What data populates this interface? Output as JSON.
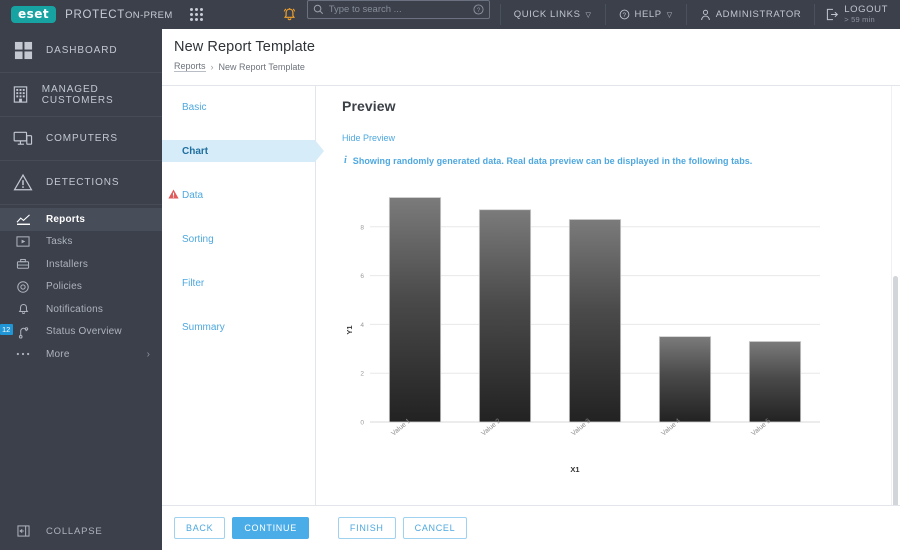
{
  "header": {
    "logo_text": "eset",
    "product_name": "PROTECT",
    "product_suffix": "ON-PREM",
    "bell_icon": "notification-bell-icon",
    "apps_icon": "app-grid-icon",
    "search_placeholder": "Type to search ...",
    "search_value": "",
    "search_help_icon": "question-circle-icon",
    "quick_links": "QUICK LINKS",
    "help": "HELP",
    "administrator": "ADMINISTRATOR",
    "logout": "LOGOUT",
    "session_time": "> 59 min"
  },
  "sidebar": {
    "main_items": [
      {
        "label": "DASHBOARD",
        "icon": "dashboard-grid-icon"
      },
      {
        "label": "MANAGED CUSTOMERS",
        "icon": "building-icon"
      },
      {
        "label": "COMPUTERS",
        "icon": "computer-icon"
      },
      {
        "label": "DETECTIONS",
        "icon": "warning-triangle-icon"
      }
    ],
    "sub_items": [
      {
        "label": "Reports",
        "icon": "chart-icon",
        "active": true,
        "badge": ""
      },
      {
        "label": "Tasks",
        "icon": "tasks-icon",
        "active": false,
        "badge": ""
      },
      {
        "label": "Installers",
        "icon": "installers-icon",
        "active": false,
        "badge": ""
      },
      {
        "label": "Policies",
        "icon": "policies-icon",
        "active": false,
        "badge": ""
      },
      {
        "label": "Notifications",
        "icon": "bell-icon",
        "active": false,
        "badge": ""
      },
      {
        "label": "Status Overview",
        "icon": "status-icon",
        "active": false,
        "badge": "12"
      },
      {
        "label": "More",
        "icon": "ellipsis-icon",
        "active": false,
        "badge": ""
      }
    ],
    "collapse_label": "COLLAPSE",
    "collapse_icon": "collapse-panel-icon"
  },
  "page": {
    "title": "New Report Template",
    "breadcrumb_root": "Reports",
    "breadcrumb_sep": "›",
    "breadcrumb_current": "New Report Template"
  },
  "tabs": [
    {
      "label": "Basic",
      "selected": false,
      "warning": false
    },
    {
      "label": "Chart",
      "selected": true,
      "warning": false
    },
    {
      "label": "Data",
      "selected": false,
      "warning": true
    },
    {
      "label": "Sorting",
      "selected": false,
      "warning": false
    },
    {
      "label": "Filter",
      "selected": false,
      "warning": false
    },
    {
      "label": "Summary",
      "selected": false,
      "warning": false
    }
  ],
  "preview": {
    "heading": "Preview",
    "hide_link": "Hide Preview",
    "info_icon": "info-icon",
    "info_message": "Showing randomly generated data. Real data preview can be displayed in the following tabs."
  },
  "chart_data": {
    "type": "bar",
    "title": "",
    "categories": [
      "Value 1",
      "Value 2",
      "Value 3",
      "Value 4",
      "Value 5"
    ],
    "values": [
      9.2,
      8.7,
      8.3,
      3.5,
      3.3
    ],
    "xlabel": "X1",
    "ylabel": "Y1",
    "ylim": [
      0,
      10
    ],
    "yticks": [
      0,
      2,
      4,
      6,
      8
    ],
    "grid": true,
    "legend": false,
    "bar_gradient_top": "#7a7a7a",
    "bar_gradient_bottom": "#262626"
  },
  "footer": {
    "back": "BACK",
    "continue": "CONTINUE",
    "finish": "FINISH",
    "cancel": "CANCEL"
  },
  "colors": {
    "accent_blue": "#4bade8",
    "brand_teal": "#18a3a3",
    "dark_chrome": "#3b404b",
    "badge_blue": "#2196d6",
    "warning_red": "#e05a5a"
  }
}
